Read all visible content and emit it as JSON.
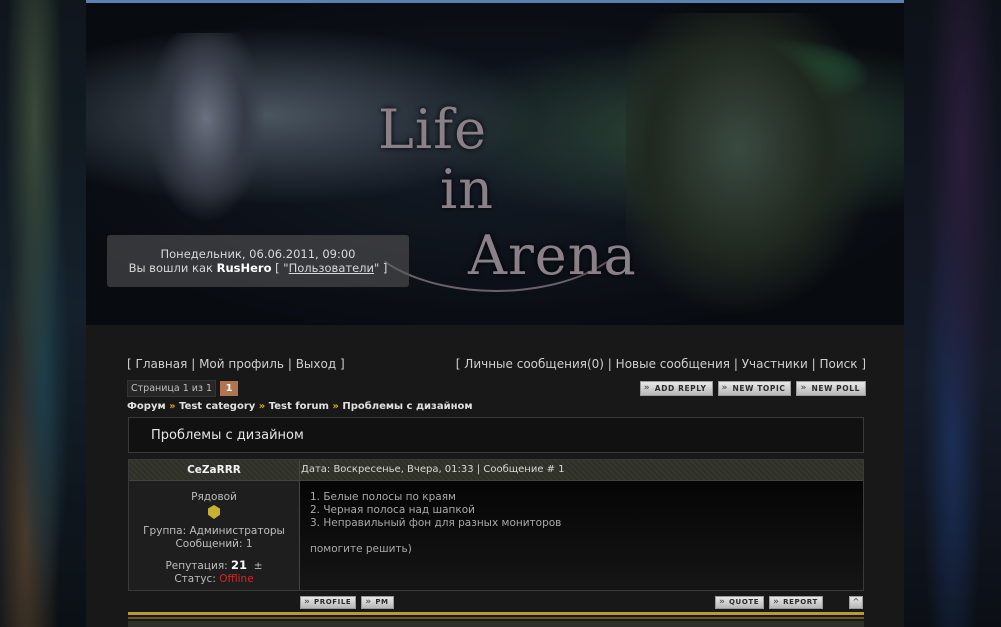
{
  "header": {
    "logo_lines": [
      "Life",
      "in",
      "Arena"
    ],
    "date_line": "Понедельник, 06.06.2011, 09:00",
    "logged_in_prefix": "Вы вошли как",
    "username": "RusHero",
    "bracket_open": "[ \"",
    "users_link": "Пользователи",
    "bracket_close": "\" ]"
  },
  "nav_left": {
    "open": "[",
    "items": [
      "Главная",
      "Мой профиль",
      "Выход"
    ],
    "sep": "|",
    "close": "]"
  },
  "nav_right": {
    "open": "[",
    "items": [
      "Личные сообщения(0)",
      "Новые сообщения",
      "Участники",
      "Поиск"
    ],
    "sep": "|",
    "close": "]"
  },
  "pager": {
    "label": "Страница 1 из 1",
    "current": "1"
  },
  "top_buttons": [
    "ADD REPLY",
    "NEW TOPIC",
    "NEW POLL"
  ],
  "breadcrumb": {
    "items": [
      "Форум",
      "Test category",
      "Test forum",
      "Проблемы с дизайном"
    ],
    "separator": "»"
  },
  "topic": {
    "title": "Проблемы с дизайном"
  },
  "post": {
    "author": "CeZaRRR",
    "meta": "Дата: Воскресенье, Вчера, 01:33 | Сообщение # 1",
    "rank": "Рядовой",
    "group": "Группа: Администраторы",
    "messages": "Сообщений: 1",
    "rep_label": "Репутация:",
    "rep_value": "21",
    "rep_pm": "±",
    "status_label": "Статус:",
    "status_value": "Offline",
    "body_lines": [
      "1. Белые полосы по краям",
      "2. Черная полоса над шапкой",
      "3. Неправильный фон для разных мониторов"
    ],
    "body_footer": "помогите решить)",
    "buttons_left": [
      "PROFILE",
      "PM"
    ],
    "buttons_right": [
      "QUOTE",
      "REPORT"
    ],
    "up_icon": "^"
  },
  "colors": {
    "accent_gold": "#d6a92c",
    "page_number_bg": "#b07550",
    "status_offline": "#d42626"
  },
  "icons": [
    "rank-badge-icon",
    "scroll-up-icon"
  ]
}
